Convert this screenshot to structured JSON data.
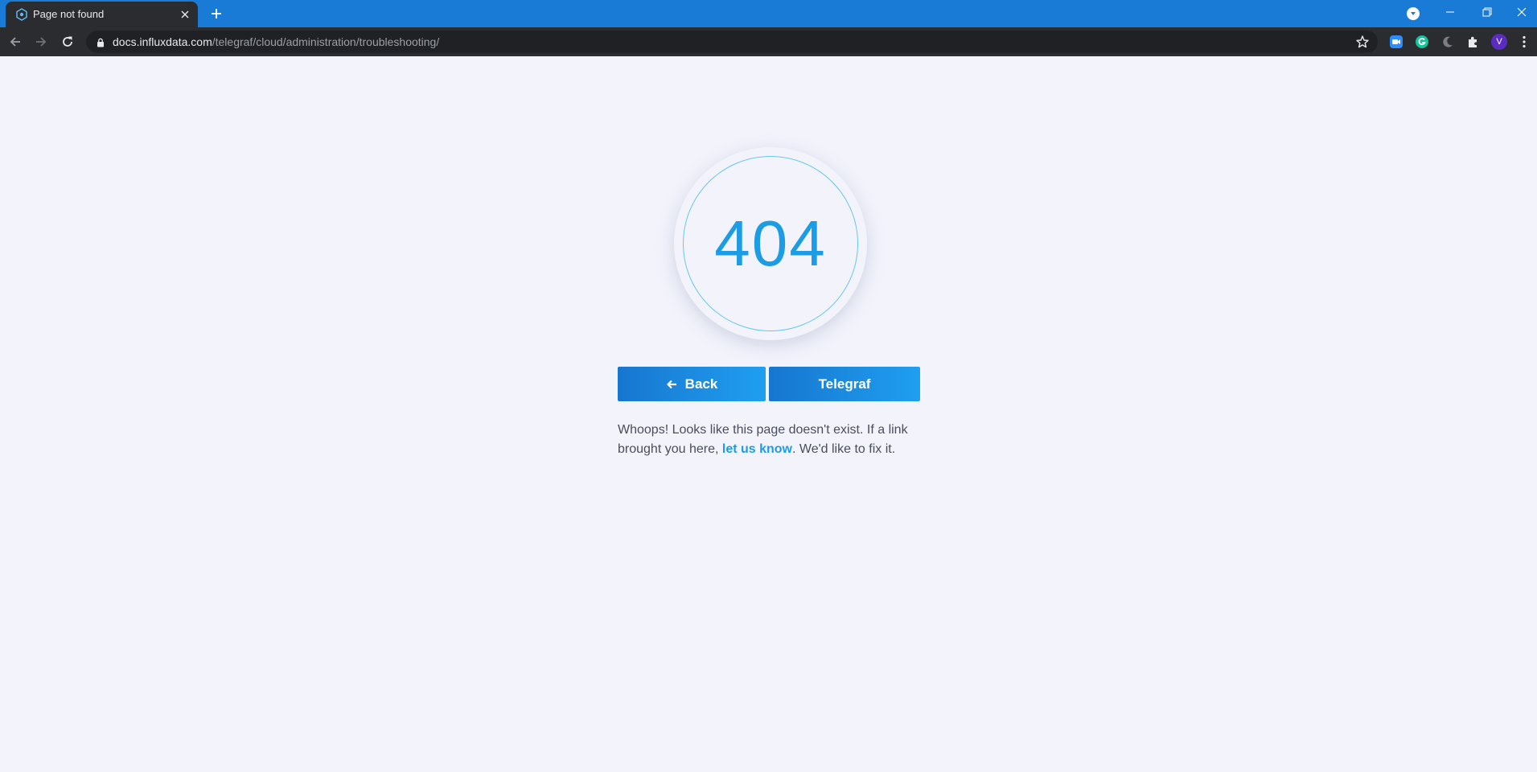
{
  "browser": {
    "tab_title": "Page not found",
    "url_host": "docs.influxdata.com",
    "url_path": "/telegraf/cloud/administration/troubleshooting/",
    "profile_initial": "V",
    "colors": {
      "tab_strip": "#1a7bd6",
      "toolbar": "#2b2c2f"
    }
  },
  "page": {
    "error_code": "404",
    "buttons": {
      "back_label": "Back",
      "telegraf_label": "Telegraf"
    },
    "message": {
      "before_link": "Whoops! Looks like this page doesn't exist. If a link brought you here, ",
      "link_text": "let us know",
      "after_link": ". We'd like to fix it."
    },
    "colors": {
      "accent": "#1d9ce6",
      "background": "#f2f3fb"
    }
  }
}
